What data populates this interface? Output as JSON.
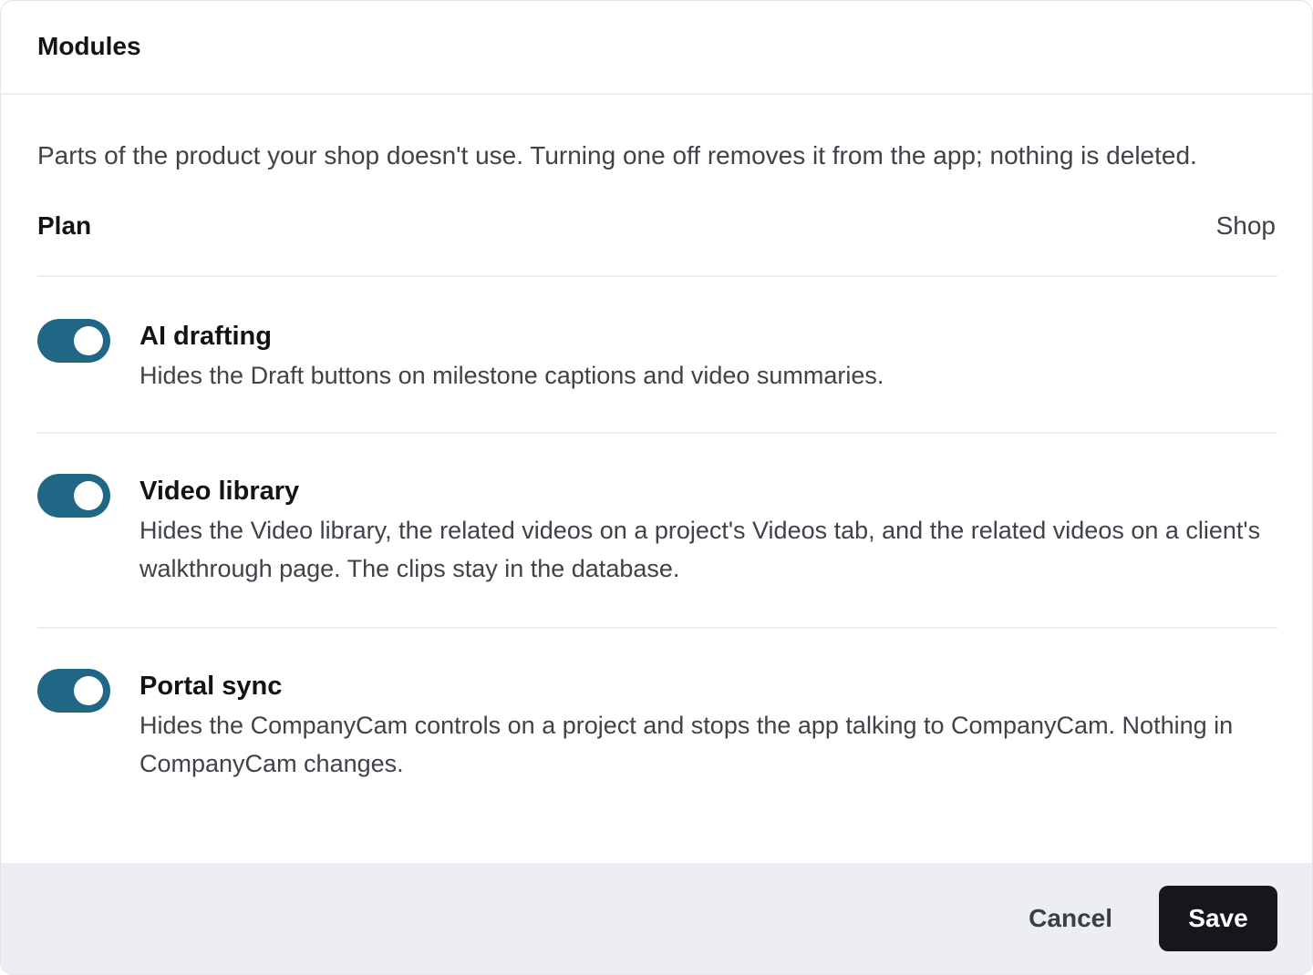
{
  "header": {
    "title": "Modules"
  },
  "intro": "Parts of the product your shop doesn't use. Turning one off removes it from the app; nothing is deleted.",
  "plan": {
    "label": "Plan",
    "value": "Shop"
  },
  "modules": [
    {
      "title": "AI drafting",
      "description": "Hides the Draft buttons on milestone captions and video summaries.",
      "enabled": true
    },
    {
      "title": "Video library",
      "description": "Hides the Video library, the related videos on a project's Videos tab, and the related videos on a client's walkthrough page. The clips stay in the database.",
      "enabled": true
    },
    {
      "title": "Portal sync",
      "description": "Hides the CompanyCam controls on a project and stops the app talking to CompanyCam. Nothing in CompanyCam changes.",
      "enabled": true
    }
  ],
  "footer": {
    "cancel_label": "Cancel",
    "save_label": "Save"
  },
  "colors": {
    "toggle_on": "#1f6785",
    "primary_button": "#15171a",
    "footer_bg": "#eceef1"
  }
}
